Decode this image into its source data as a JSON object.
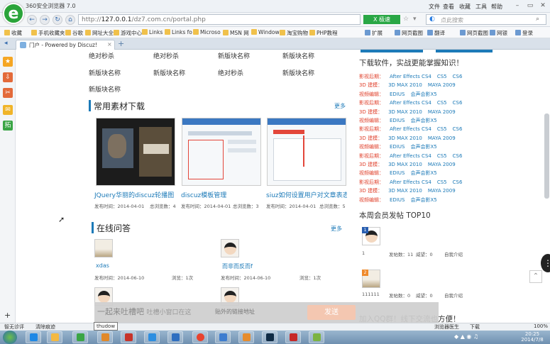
{
  "window": {
    "title": "360安全浏览器 7.0",
    "menus": [
      "文件",
      "查看",
      "收藏",
      "工具",
      "帮助"
    ]
  },
  "nav": {
    "url_prefix": "http://",
    "url_host": "127.0.0.1",
    "url_path": "/dz7.com.cn/portal.php",
    "speed_label": "X 极速",
    "search_placeholder": "点此搜索"
  },
  "bookmarks": [
    "收藏",
    "手机收藏夹",
    "谷歌",
    "网址大全",
    "游戏中心",
    "Links",
    "Links fo",
    "Microso",
    "MSN 网",
    "Window",
    "淘宝购物",
    "PHP教程",
    "扩展",
    "网页截图",
    "翻译",
    "游戏",
    "网页截图",
    "网银",
    "登录"
  ],
  "tab": {
    "label": "门户 - Powered by Discuz!"
  },
  "content": {
    "block_links": [
      [
        "绝对秒杀",
        "绝对秒杀",
        "新版块名称",
        "新版块名称"
      ],
      [
        "新版块名称",
        "新版块名称",
        "绝对秒杀",
        "新版块名称"
      ],
      [
        "新版块名称"
      ]
    ],
    "materials": {
      "title": "常用素材下载",
      "more": "更多",
      "items": [
        {
          "caption": "JQuery华丽的discuz轮播图",
          "time": "发布时间：2014-04-01",
          "views": "总浏览数：4"
        },
        {
          "caption": "discuz模板管理",
          "time": "发布时间：2014-04-01",
          "views": "总浏览数：3"
        },
        {
          "caption": "siuz如何设置用户对文章表态",
          "time": "发布时间：2014-04-01",
          "views": "总浏览数：5"
        }
      ]
    },
    "qa": {
      "title": "在线问答",
      "more": "更多",
      "items": [
        {
          "title": "xdas",
          "time": "发布时间：2014-06-10",
          "views": "浏览：1次"
        },
        {
          "title": "而非而反而f",
          "time": "发布时间：2014-06-10",
          "views": "浏览：1次"
        }
      ]
    },
    "right": {
      "heading": "下载软件，实战更能掌握知识！",
      "rows": [
        {
          "label": "影视后期：",
          "items": [
            "After Effects CS4",
            "CS5",
            "CS6"
          ]
        },
        {
          "label": "3D 建模：",
          "items": [
            "3D MAX 2010",
            "MAYA 2009"
          ]
        },
        {
          "label": "视频编辑：",
          "items": [
            "EDIUS",
            "会声会影X5"
          ]
        }
      ],
      "top10_title": "本周会员发帖 TOP10",
      "members": [
        {
          "rank": "1",
          "name": "1",
          "posts": "发帖数：11",
          "threads": "威望：0",
          "intro": "自我介绍"
        },
        {
          "rank": "2",
          "name": "111111",
          "posts": "发帖数：0",
          "threads": "威望：0",
          "intro": "自我介绍"
        }
      ],
      "qq_group": "加入QQ群！线下交流也方便！"
    }
  },
  "popup": {
    "input_placeholder": "一起来吐槽吧",
    "input_ghost": "吐槽小窗口在这",
    "link_placeholder": "贴外的链接地址",
    "send": "发送",
    "tooltip": "thudow"
  },
  "statusbar": {
    "left": [
      "智无诊评",
      "清除痕迹"
    ],
    "right": [
      "浏览器医生",
      "下载",
      "100%"
    ]
  },
  "clock": {
    "time": "20:25",
    "date": "2014/7/8"
  }
}
